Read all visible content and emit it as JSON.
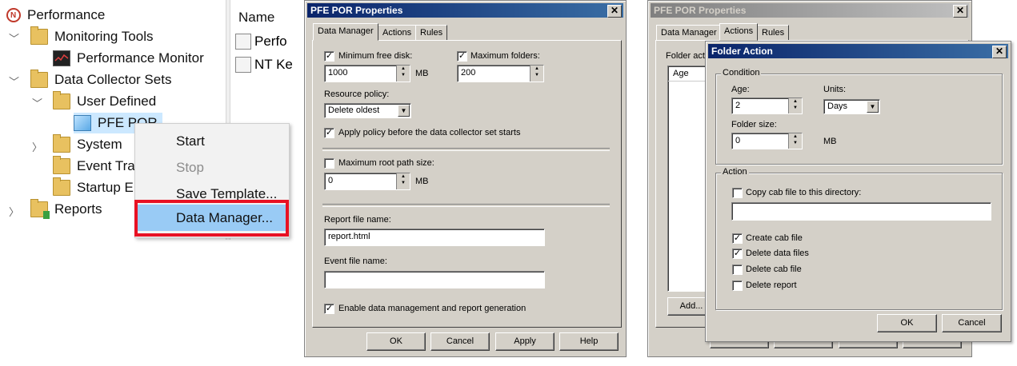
{
  "tree": {
    "root": "Performance",
    "items": [
      {
        "label": "Monitoring Tools"
      },
      {
        "label": "Performance Monitor"
      },
      {
        "label": "Data Collector Sets"
      },
      {
        "label": "User Defined"
      },
      {
        "label": "PFE POR"
      },
      {
        "label": "System"
      },
      {
        "label": "Event Tra"
      },
      {
        "label": "Startup E"
      },
      {
        "label": "Reports"
      }
    ]
  },
  "list": {
    "header": "Name",
    "items": [
      "Perfo",
      "NT Ke"
    ]
  },
  "context_menu": {
    "items": [
      {
        "label": "Start",
        "enabled": true
      },
      {
        "label": "Stop",
        "enabled": false
      },
      {
        "label": "Save Template...",
        "enabled": true
      },
      {
        "label": "Data Manager...",
        "enabled": true,
        "highlighted": true
      }
    ],
    "highlight_color": "#cce8ff",
    "callout_color": "#e81123"
  },
  "dialog1": {
    "title": "PFE POR Properties",
    "close": "✕",
    "tabs": [
      "Data Manager",
      "Actions",
      "Rules"
    ],
    "min_free_disk": {
      "label": "Minimum free disk:",
      "checked": true,
      "value": "1000",
      "unit": "MB"
    },
    "max_folders": {
      "label": "Maximum folders:",
      "checked": true,
      "value": "200"
    },
    "resource_policy": {
      "label": "Resource policy:",
      "value": "Delete oldest"
    },
    "apply_policy": {
      "label": "Apply policy before the data collector set starts",
      "checked": true
    },
    "max_root_path": {
      "label": "Maximum root path size:",
      "checked": false,
      "value": "0",
      "unit": "MB"
    },
    "report_file": {
      "label": "Report file name:",
      "value": "report.html"
    },
    "event_file": {
      "label": "Event file name:",
      "value": ""
    },
    "enable_mgmt": {
      "label": "Enable data management and report generation",
      "checked": true
    },
    "buttons": {
      "ok": "OK",
      "cancel": "Cancel",
      "apply": "Apply",
      "help": "Help"
    }
  },
  "dialog2": {
    "title": "PFE POR Properties",
    "close": "✕",
    "tabs": [
      "Data Manager",
      "Actions",
      "Rules"
    ],
    "folder_actions_label": "Folder act",
    "list_header": "Age",
    "add_button": "Add..."
  },
  "folder_action": {
    "title": "Folder Action",
    "close": "✕",
    "condition": {
      "group": "Condition",
      "age_label": "Age:",
      "age_value": "2",
      "units_label": "Units:",
      "units_value": "Days",
      "folder_size_label": "Folder size:",
      "folder_size_value": "0",
      "folder_size_unit": "MB"
    },
    "action": {
      "group": "Action",
      "copy_cab": {
        "label": "Copy cab file to this directory:",
        "checked": false
      },
      "directory_value": "",
      "create_cab": {
        "label": "Create cab file",
        "checked": true
      },
      "delete_data": {
        "label": "Delete data files",
        "checked": true
      },
      "delete_cab": {
        "label": "Delete cab file",
        "checked": false
      },
      "delete_report": {
        "label": "Delete report",
        "checked": false
      }
    },
    "buttons": {
      "ok": "OK",
      "cancel": "Cancel"
    }
  },
  "checkmark_glyph": "✓"
}
